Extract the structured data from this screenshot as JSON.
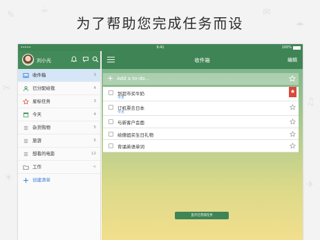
{
  "headline": "为了帮助您完成任务而设",
  "statusbar": {
    "signal": "•••••",
    "time": "9:41",
    "battery": "100%"
  },
  "sidebar": {
    "username": "刘小光",
    "lists": [
      {
        "label": "收件箱",
        "count": "3",
        "icon": "inbox-icon",
        "active": true
      },
      {
        "label": "已分配给我",
        "count": "4",
        "icon": "assigned-to-me-icon"
      },
      {
        "label": "星标任务",
        "count": "3",
        "icon": "star-outline-icon"
      },
      {
        "label": "今天",
        "count": "4",
        "icon": "calendar-today-icon"
      },
      {
        "label": "杂货购物",
        "count": "5",
        "icon": "list-icon"
      },
      {
        "label": "旅游",
        "count": "5",
        "icon": "list-icon"
      },
      {
        "label": "想看的电影",
        "count": "12",
        "icon": "list-icon"
      },
      {
        "label": "工作",
        "count": "<",
        "icon": "folder-icon"
      }
    ],
    "create_label": "创建清单"
  },
  "main": {
    "title": "收件箱",
    "edit_label": "编辑",
    "add_placeholder": "Add a to-do...",
    "tasks": [
      {
        "text": "到超市买牛奶",
        "due": "今天",
        "starred": true
      },
      {
        "text": "订机票去日本",
        "due": "今天",
        "starred": false
      },
      {
        "text": "与新客户会面",
        "due": "",
        "starred": false
      },
      {
        "text": "给傻妞买生日礼物",
        "due": "",
        "starred": false
      },
      {
        "text": "背诵英语单词",
        "due": "",
        "starred": false
      }
    ],
    "show_completed_label": "显示已完成任务"
  },
  "colors": {
    "green": "#3f8455",
    "accent_blue": "#3b7dd8",
    "star_red": "#d9493c"
  }
}
